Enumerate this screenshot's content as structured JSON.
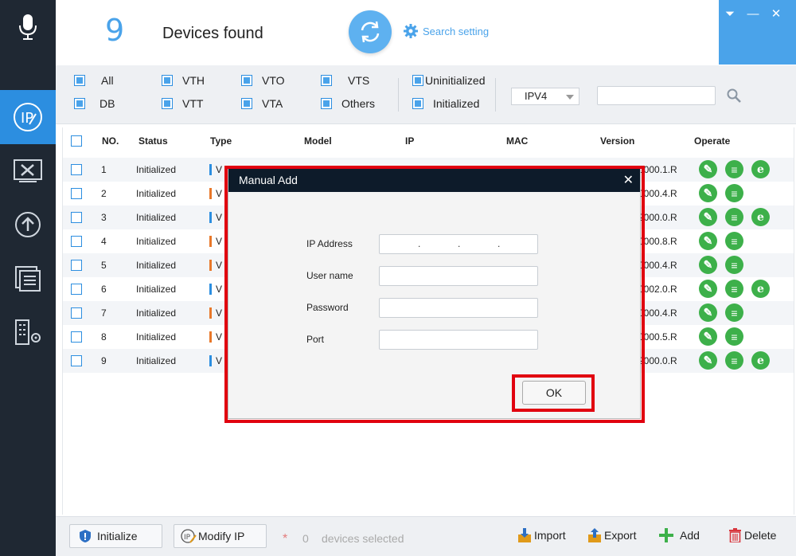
{
  "header": {
    "count": "9",
    "found_label": "Devices found",
    "search_setting": "Search setting"
  },
  "window": {
    "dropdown": "⏷",
    "minimize": "—",
    "close": "✕"
  },
  "filters": {
    "row1": [
      "All",
      "VTH",
      "VTO",
      "VTS",
      "Uninitialized"
    ],
    "row2": [
      "DB",
      "VTT",
      "VTA",
      "Others",
      "Initialized"
    ],
    "ip_version": "IPV4",
    "search_value": ""
  },
  "table": {
    "headers": {
      "no": "NO.",
      "status": "Status",
      "type": "Type",
      "model": "Model",
      "ip": "IP",
      "mac": "MAC",
      "version": "Version",
      "operate": "Operate"
    },
    "rows": [
      {
        "no": "1",
        "status": "Initialized",
        "type": "V",
        "version": "0000.1.R"
      },
      {
        "no": "2",
        "status": "Initialized",
        "type": "V",
        "version": "0000.4.R"
      },
      {
        "no": "3",
        "status": "Initialized",
        "type": "V",
        "version": "2000.0.R"
      },
      {
        "no": "4",
        "status": "Initialized",
        "type": "V",
        "version": "0000.8.R"
      },
      {
        "no": "5",
        "status": "Initialized",
        "type": "V",
        "version": "0000.4.R"
      },
      {
        "no": "6",
        "status": "Initialized",
        "type": "V",
        "version": "0002.0.R"
      },
      {
        "no": "7",
        "status": "Initialized",
        "type": "V",
        "version": "0000.4.R"
      },
      {
        "no": "8",
        "status": "Initialized",
        "type": "V",
        "version": "0000.5.R"
      },
      {
        "no": "9",
        "status": "Initialized",
        "type": "V",
        "version": "2000.0.R"
      }
    ],
    "op_edit_icon": "✎",
    "op_detail_icon": "≡",
    "op_web_icon": "e"
  },
  "footer": {
    "initialize": "Initialize",
    "modify_ip": "Modify IP",
    "asterisk": "*",
    "selected_count": "0",
    "selected_label": "devices selected",
    "import": "Import",
    "export": "Export",
    "add": "Add",
    "delete": "Delete"
  },
  "modal": {
    "title": "Manual Add",
    "close": "✕",
    "ip_label": "IP Address",
    "user_label": "User name",
    "password_label": "Password",
    "port_label": "Port",
    "ip_dot": ".",
    "ok": "OK"
  },
  "colors": {
    "sidebar": "#1f2833",
    "accent": "#4aa3ea",
    "highlight": "#e1000f",
    "op_green": "#3db04a"
  }
}
